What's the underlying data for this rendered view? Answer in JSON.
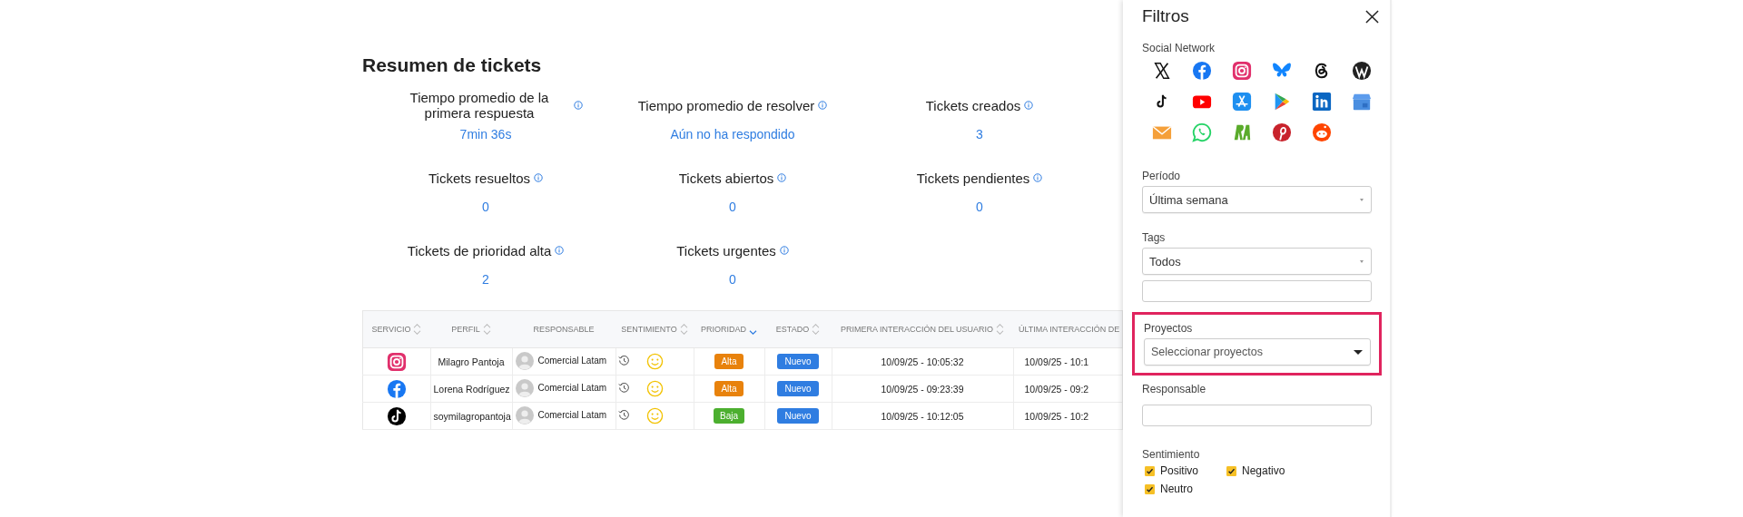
{
  "summary": {
    "title": "Resumen de tickets",
    "metrics": [
      {
        "label": "Tiempo promedio de la primera respuesta",
        "value": "7min 36s"
      },
      {
        "label": "Tiempo promedio de resolver",
        "value": "Aún no ha respondido"
      },
      {
        "label": "Tickets creados",
        "value": "3"
      },
      {
        "label": "Tickets resueltos",
        "value": "0"
      },
      {
        "label": "Tickets abiertos",
        "value": "0"
      },
      {
        "label": "Tickets pendientes",
        "value": "0"
      },
      {
        "label": "Tickets de prioridad alta",
        "value": "2"
      },
      {
        "label": "Tickets urgentes",
        "value": "0"
      }
    ]
  },
  "table": {
    "columns": [
      {
        "label": "SERVICIO",
        "sortable": true,
        "sorted": false
      },
      {
        "label": "PERFIL",
        "sortable": true,
        "sorted": false
      },
      {
        "label": "RESPONSABLE",
        "sortable": false
      },
      {
        "label": "SENTIMIENTO",
        "sortable": true,
        "sorted": false
      },
      {
        "label": "PRIORIDAD",
        "sortable": true,
        "sorted": true
      },
      {
        "label": "ESTADO",
        "sortable": true,
        "sorted": false
      },
      {
        "label": "PRIMERA INTERACCIÓN DEL USUARIO",
        "sortable": true,
        "sorted": false
      },
      {
        "label": "ÚLTIMA INTERACCIÓN DE",
        "sortable": false
      }
    ],
    "rows": [
      {
        "service": {
          "kind": "instagram"
        },
        "profile": "Milagro Pantoja",
        "agent": "Comercial Latam",
        "sentiment": {
          "kind": "positive"
        },
        "priority": {
          "label": "Alta",
          "kind": "high"
        },
        "status": "Nuevo",
        "first": "10/09/25 - 10:05:32",
        "last": "10/09/25 - 10:1"
      },
      {
        "service": {
          "kind": "facebook"
        },
        "profile": "Lorena Rodríguez",
        "agent": "Comercial Latam",
        "sentiment": {
          "kind": "positive"
        },
        "priority": {
          "label": "Alta",
          "kind": "high"
        },
        "status": "Nuevo",
        "first": "10/09/25 - 09:23:39",
        "last": "10/09/25 - 09:2"
      },
      {
        "service": {
          "kind": "tiktok"
        },
        "profile": "soymilagropantoja",
        "agent": "Comercial Latam",
        "sentiment": {
          "kind": "positive"
        },
        "priority": {
          "label": "Baja",
          "kind": "low"
        },
        "status": "Nuevo",
        "first": "10/09/25 - 10:12:05",
        "last": "10/09/25 - 10:2"
      }
    ]
  },
  "filters": {
    "title": "Filtros",
    "social_network": {
      "label": "Social Network",
      "networks": [
        {
          "kind": "x"
        },
        {
          "kind": "facebook"
        },
        {
          "kind": "instagram"
        },
        {
          "kind": "bluesky"
        },
        {
          "kind": "threads"
        },
        {
          "kind": "wordpress"
        },
        {
          "kind": "tiktok"
        },
        {
          "kind": "youtube"
        },
        {
          "kind": "appstore"
        },
        {
          "kind": "googleplay"
        },
        {
          "kind": "linkedin"
        },
        {
          "kind": "gbusiness"
        },
        {
          "kind": "email"
        },
        {
          "kind": "whatsapp"
        },
        {
          "kind": "ra"
        },
        {
          "kind": "pinterest"
        },
        {
          "kind": "reddit"
        }
      ]
    },
    "period": {
      "label": "Período",
      "value": "Última semana"
    },
    "tags": {
      "label": "Tags",
      "value": "Todos"
    },
    "projects": {
      "label": "Proyectos",
      "placeholder": "Seleccionar proyectos",
      "highlighted": true
    },
    "responsible": {
      "label": "Responsable"
    },
    "sentiment": {
      "label": "Sentimiento",
      "options": [
        {
          "label": "Positivo",
          "checked": true
        },
        {
          "label": "Negativo",
          "checked": true
        },
        {
          "label": "Neutro",
          "checked": true
        }
      ]
    }
  }
}
